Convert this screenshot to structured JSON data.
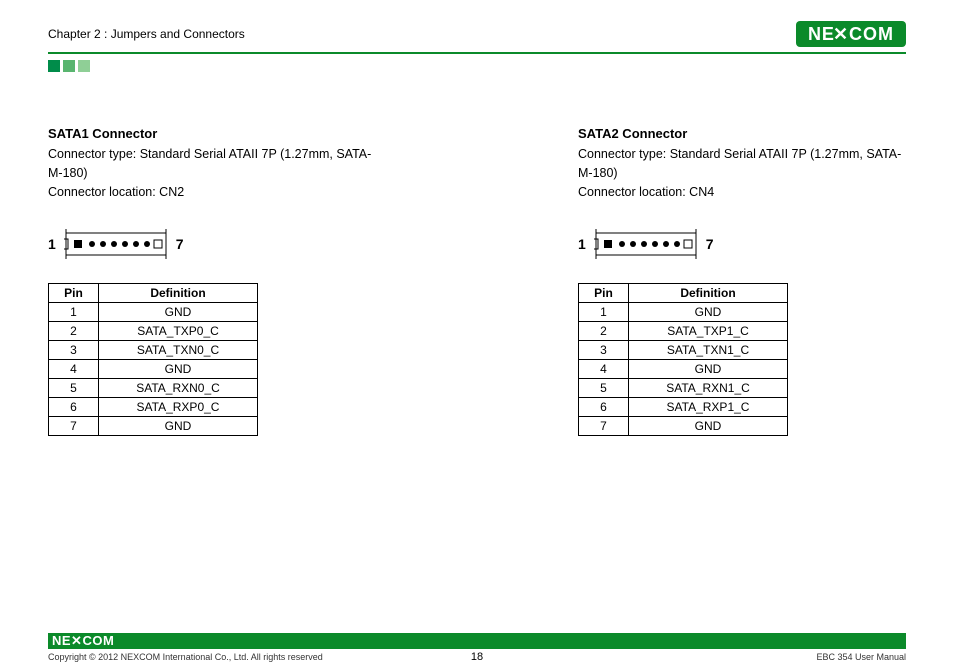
{
  "header": {
    "chapter": "Chapter 2 : Jumpers and Connectors",
    "logo_text": "NEXCOM"
  },
  "left": {
    "title": "SATA1 Connector",
    "type_line": "Connector type: Standard Serial ATAII 7P (1.27mm, SATA-M-180)",
    "loc_line": "Connector location: CN2",
    "label_left": "1",
    "label_right": "7",
    "table": {
      "h1": "Pin",
      "h2": "Definition",
      "rows": [
        {
          "pin": "1",
          "def": "GND"
        },
        {
          "pin": "2",
          "def": "SATA_TXP0_C"
        },
        {
          "pin": "3",
          "def": "SATA_TXN0_C"
        },
        {
          "pin": "4",
          "def": "GND"
        },
        {
          "pin": "5",
          "def": "SATA_RXN0_C"
        },
        {
          "pin": "6",
          "def": "SATA_RXP0_C"
        },
        {
          "pin": "7",
          "def": "GND"
        }
      ]
    }
  },
  "right": {
    "title": "SATA2 Connector",
    "type_line": "Connector type: Standard Serial ATAII 7P (1.27mm, SATA-M-180)",
    "loc_line": "Connector location: CN4",
    "label_left": "1",
    "label_right": "7",
    "table": {
      "h1": "Pin",
      "h2": "Definition",
      "rows": [
        {
          "pin": "1",
          "def": "GND"
        },
        {
          "pin": "2",
          "def": "SATA_TXP1_C"
        },
        {
          "pin": "3",
          "def": "SATA_TXN1_C"
        },
        {
          "pin": "4",
          "def": "GND"
        },
        {
          "pin": "5",
          "def": "SATA_RXN1_C"
        },
        {
          "pin": "6",
          "def": "SATA_RXP1_C"
        },
        {
          "pin": "7",
          "def": "GND"
        }
      ]
    }
  },
  "footer": {
    "logo_text": "NEXCOM",
    "copyright": "Copyright © 2012 NEXCOM International Co., Ltd. All rights reserved",
    "page": "18",
    "manual": "EBC 354 User Manual"
  }
}
